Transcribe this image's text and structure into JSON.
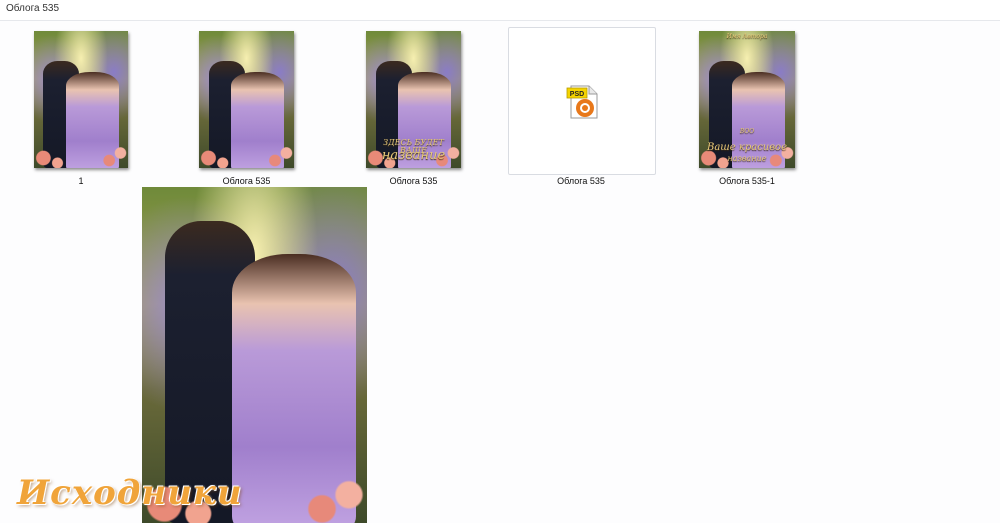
{
  "window": {
    "title": "Облога 535"
  },
  "files": [
    {
      "name": "1",
      "type": "image"
    },
    {
      "name": "Облога  535",
      "type": "image"
    },
    {
      "name": "Облога 535",
      "type": "image-with-title",
      "cover_title_line1": "ЗДЕСЬ БУДЕТ ВАШЕ",
      "cover_title_line2": "название"
    },
    {
      "name": "Облога 535",
      "type": "psd",
      "badge": "PSD"
    },
    {
      "name": "Облога 535-1",
      "type": "image-with-title",
      "author": "Имя Автора",
      "cover_subtitle": "BOO",
      "cover_title_line1": "Ваше красивое",
      "cover_title_line2": "название"
    }
  ],
  "preview": {
    "type": "image"
  },
  "watermark": {
    "text": "Исходники"
  },
  "colors": {
    "accent": "#f0a43a",
    "psd_badge": "#f5d400",
    "psd_orange": "#e8781a"
  }
}
